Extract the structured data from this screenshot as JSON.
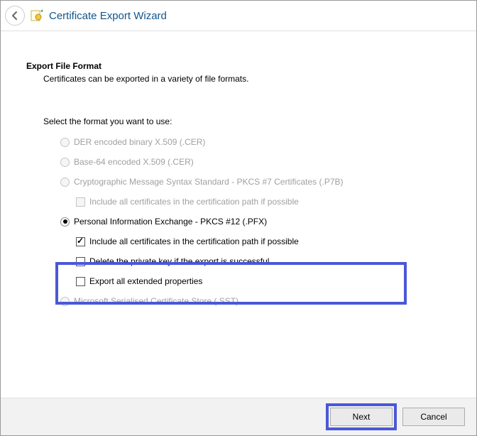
{
  "title": "Certificate Export Wizard",
  "heading": "Export File Format",
  "subheading": "Certificates can be exported in a variety of file formats.",
  "select_label": "Select the format you want to use:",
  "options": {
    "der": "DER encoded binary X.509 (.CER)",
    "b64": "Base-64 encoded X.509 (.CER)",
    "p7b": "Cryptographic Message Syntax Standard - PKCS #7 Certificates (.P7B)",
    "p7b_include": "Include all certificates in the certification path if possible",
    "pfx": "Personal Information Exchange - PKCS #12 (.PFX)",
    "pfx_include": "Include all certificates in the certification path if possible",
    "pfx_delete": "Delete the private key if the export is successful",
    "pfx_ext": "Export all extended properties",
    "sst": "Microsoft Serialised Certificate Store (.SST)"
  },
  "buttons": {
    "next": "Next",
    "cancel": "Cancel"
  }
}
